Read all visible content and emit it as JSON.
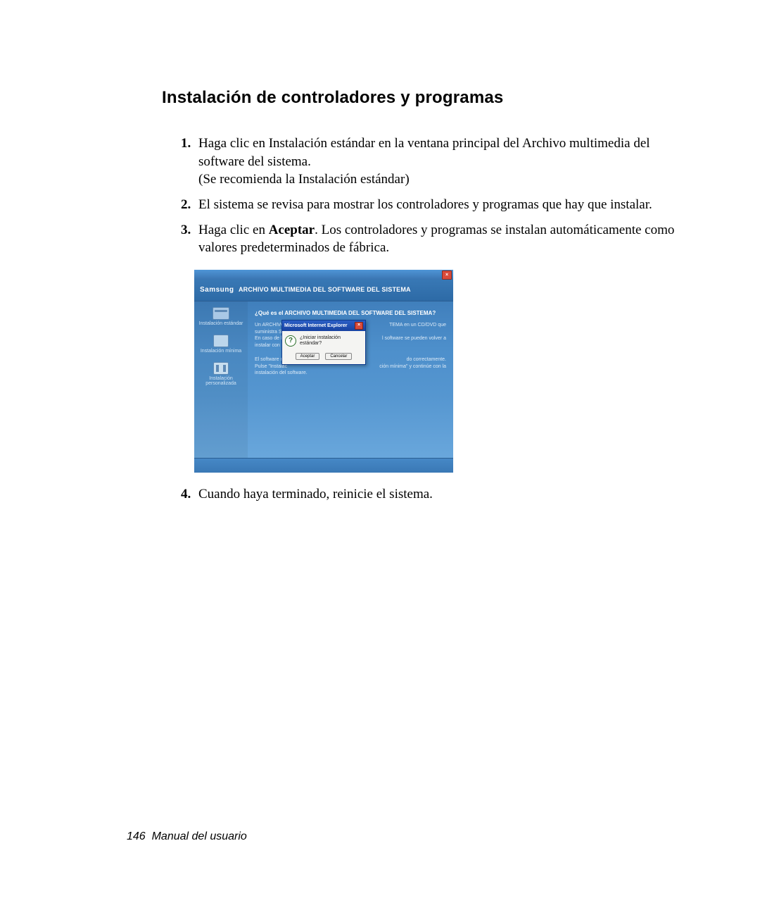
{
  "heading": "Instalación de controladores y programas",
  "steps": {
    "s1_line1": "Haga clic en Instalación estándar en la ventana principal del Archivo multimedia del software del sistema.",
    "s1_line2": "(Se recomienda la Instalación estándar)",
    "s2": "El sistema se revisa para mostrar los controladores y programas que hay que instalar.",
    "s3_pre": "Haga clic en ",
    "s3_bold": "Aceptar",
    "s3_post": ". Los controladores y programas se instalan automáticamente como valores predeterminados de fábrica.",
    "s4": "Cuando haya terminado, reinicie el sistema."
  },
  "installer": {
    "brand": "Samsung",
    "title": "ARCHIVO MULTIMEDIA DEL SOFTWARE DEL SISTEMA",
    "close_glyph": "×",
    "sidebar": {
      "item1": "Instalación estándar",
      "item2": "Instalación mínima",
      "item3": "Instalación personalizada"
    },
    "content": {
      "question": "¿Qué es el ARCHIVO MULTIMEDIA DEL SOFTWARE DEL SISTEMA?",
      "p1a": "Un ARCHIVO M",
      "p1b": "TEMA en un CD/DVD que",
      "p2a": "suministra Sam",
      "p3a": "En caso de blo",
      "p3b": "l software se pueden volver a",
      "p4a": "instalar con fac",
      "p5a": "El software nec",
      "p5b": "do correctamente.",
      "p6a": "Pulse \"Instalac",
      "p6b": "ción mínima\" y continúe con la",
      "p7a": "instalación del software."
    },
    "dialog": {
      "title": "Microsoft Internet Explorer",
      "close_glyph": "×",
      "qmark": "?",
      "message": "¿Iniciar instalación estándar?",
      "accept": "Aceptar",
      "cancel": "Cancelar"
    }
  },
  "footer": {
    "page": "146",
    "label": "Manual del usuario"
  }
}
